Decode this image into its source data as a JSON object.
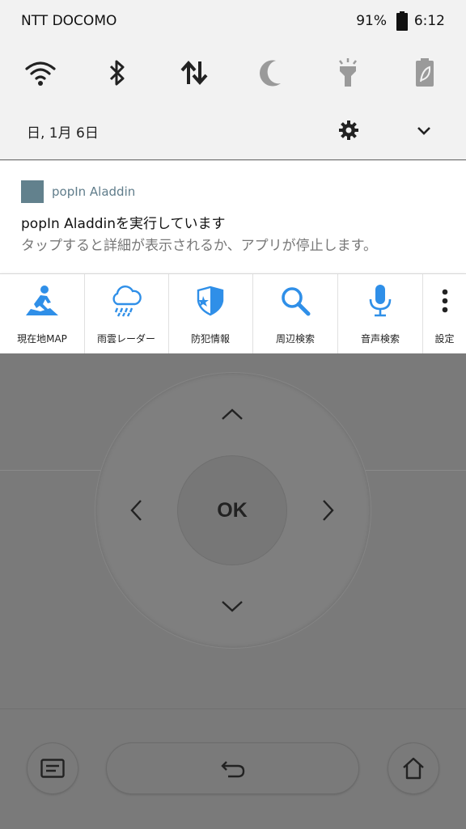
{
  "status_bar": {
    "carrier": "NTT DOCOMO",
    "battery_percent": "91%",
    "time": "6:12"
  },
  "quick_settings": {
    "tiles": [
      {
        "name": "wifi-icon",
        "state": "on"
      },
      {
        "name": "bluetooth-icon",
        "state": "on"
      },
      {
        "name": "mobile-data-icon",
        "state": "on"
      },
      {
        "name": "do-not-disturb-icon",
        "state": "off"
      },
      {
        "name": "flashlight-icon",
        "state": "off"
      },
      {
        "name": "battery-saver-icon",
        "state": "off"
      }
    ],
    "date": "日, 1月 6日"
  },
  "notification": {
    "app_name": "popIn Aladdin",
    "title": "popIn Aladdinを実行しています",
    "text": "タップすると詳細が表示されるか、アプリが停止します。",
    "app_icon_color": "#62818d"
  },
  "actions": [
    {
      "label": "現在地MAP",
      "icon": "walking-map-icon"
    },
    {
      "label": "雨雲レーダー",
      "icon": "rain-cloud-icon"
    },
    {
      "label": "防犯情報",
      "icon": "shield-icon"
    },
    {
      "label": "周辺検索",
      "icon": "search-icon"
    },
    {
      "label": "音声検索",
      "icon": "microphone-icon"
    },
    {
      "label": "設定",
      "icon": "more-vert-icon"
    }
  ],
  "remote": {
    "ok_label": "OK"
  },
  "colors": {
    "accent_blue": "#2f8fe8",
    "shade_bg": "#f2f2f2",
    "scrim": "#7a7a7a"
  }
}
